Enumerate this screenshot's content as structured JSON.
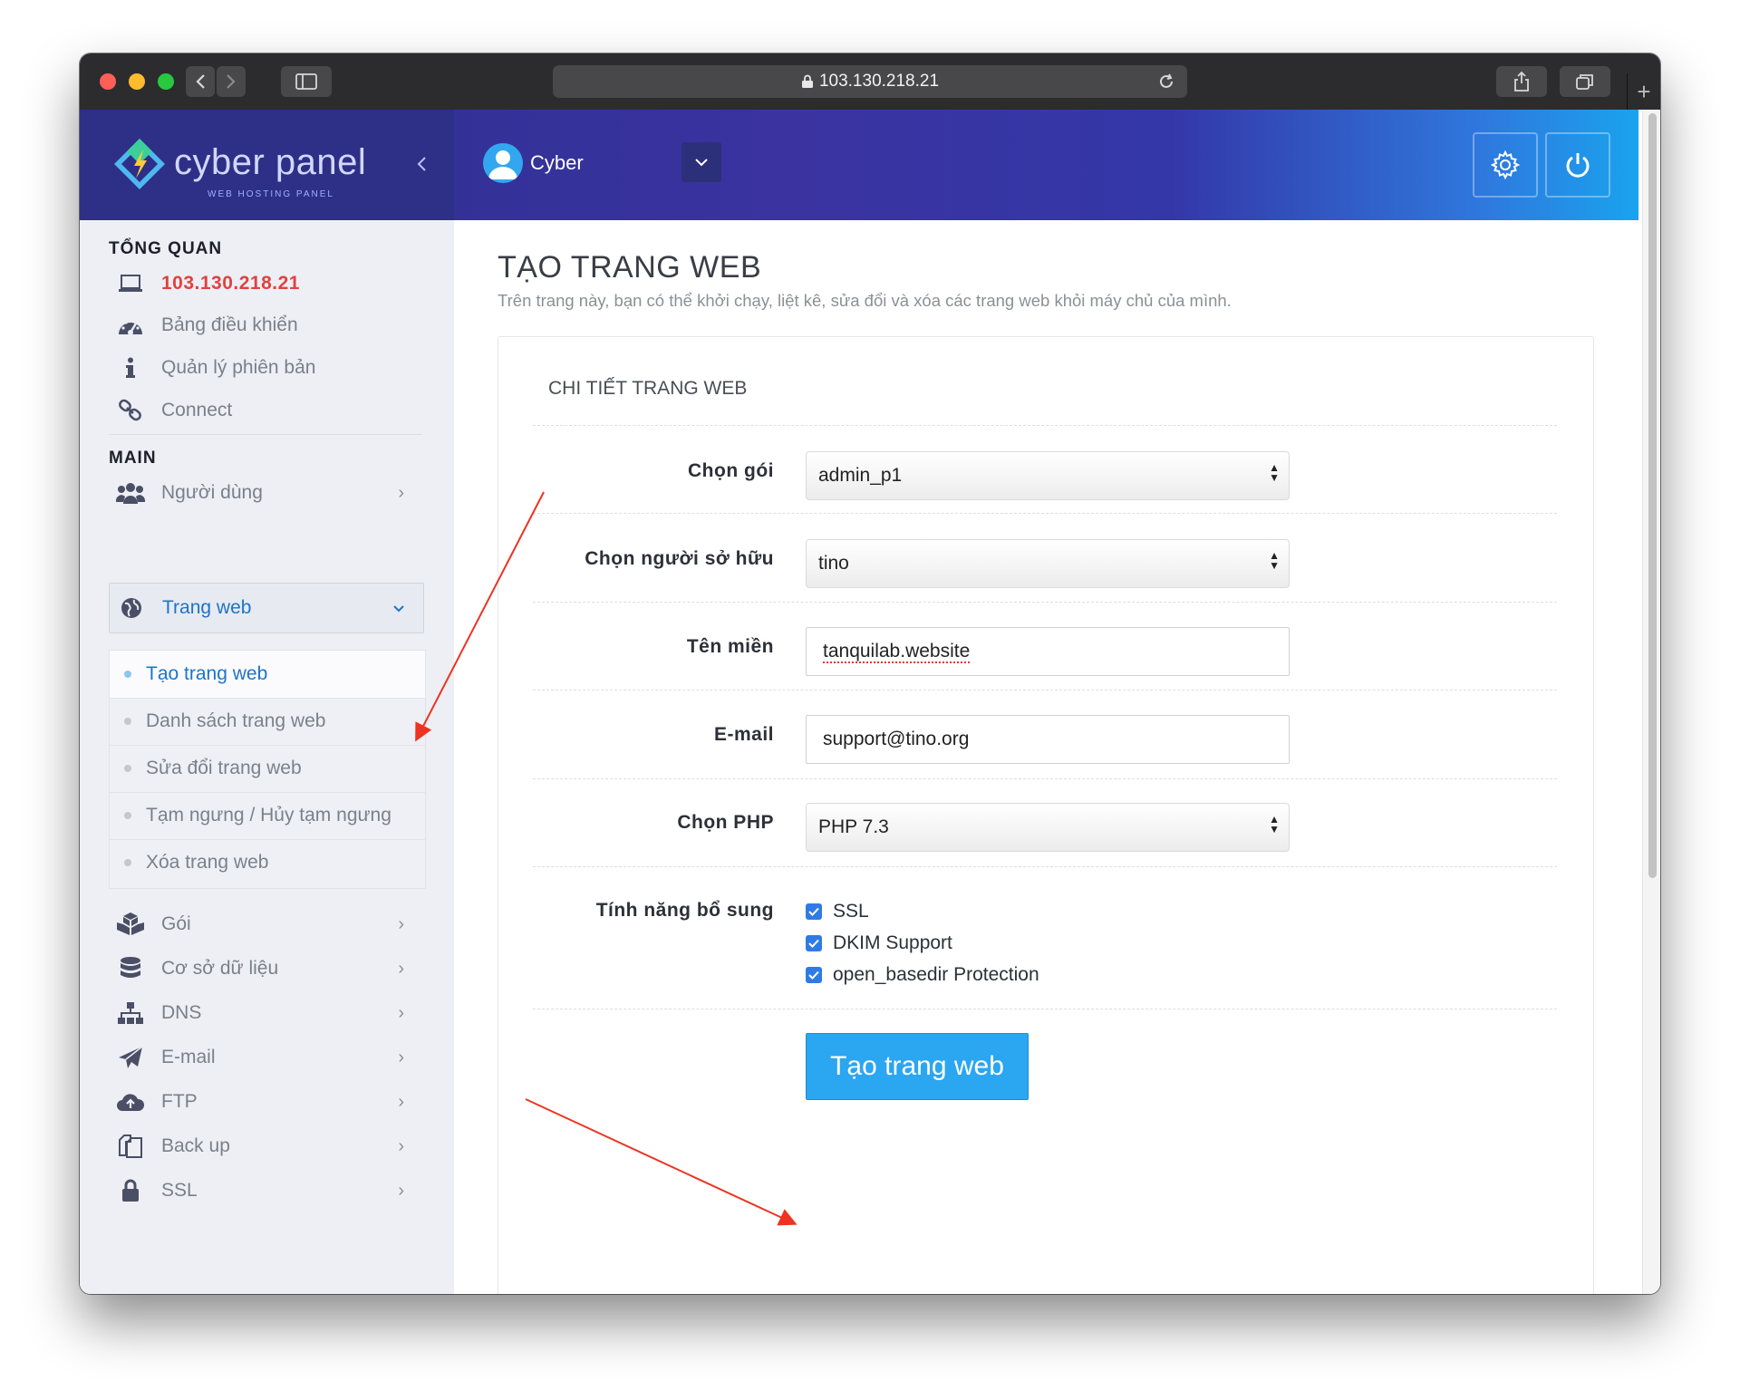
{
  "browser": {
    "url": "103.130.218.21"
  },
  "header": {
    "logo_text": "cyber panel",
    "logo_sub": "WEB HOSTING PANEL",
    "user_name": "Cyber"
  },
  "sidebar": {
    "overview_title": "TỔNG QUAN",
    "server_ip": "103.130.218.21",
    "overview_items": [
      {
        "label": "Bảng điều khiển",
        "icon": "dashboard-icon"
      },
      {
        "label": "Quản lý phiên bản",
        "icon": "info-icon"
      },
      {
        "label": "Connect",
        "icon": "link-icon"
      }
    ],
    "main_title": "MAIN",
    "users_label": "Người dùng",
    "websites_label": "Trang web",
    "website_submenu": [
      {
        "label": "Tạo trang web",
        "active": true
      },
      {
        "label": "Danh sách trang web",
        "active": false
      },
      {
        "label": "Sửa đổi trang web",
        "active": false
      },
      {
        "label": "Tạm ngưng / Hủy tạm ngưng",
        "active": false
      },
      {
        "label": "Xóa trang web",
        "active": false
      }
    ],
    "main_items": [
      {
        "label": "Gói",
        "icon": "packages-icon"
      },
      {
        "label": "Cơ sở dữ liệu",
        "icon": "database-icon"
      },
      {
        "label": "DNS",
        "icon": "sitemap-icon"
      },
      {
        "label": "E-mail",
        "icon": "paper-plane-icon"
      },
      {
        "label": "FTP",
        "icon": "cloud-upload-icon"
      },
      {
        "label": "Back up",
        "icon": "copy-icon"
      },
      {
        "label": "SSL",
        "icon": "lock-icon"
      }
    ]
  },
  "main": {
    "title": "TẠO TRANG WEB",
    "description": "Trên trang này, bạn có thể khởi chạy, liệt kê, sửa đổi và xóa các trang web khỏi máy chủ của mình.",
    "card_title": "CHI TIẾT TRANG WEB",
    "form": {
      "package_label": "Chọn gói",
      "package_value": "admin_p1",
      "owner_label": "Chọn người sở hữu",
      "owner_value": "tino",
      "domain_label": "Tên miền",
      "domain_value": "tanquilab.website",
      "email_label": "E-mail",
      "email_value": "support@tino.org",
      "php_label": "Chọn PHP",
      "php_value": "PHP 7.3",
      "features_label": "Tính năng bổ sung",
      "features": [
        {
          "label": "SSL",
          "checked": true
        },
        {
          "label": "DKIM Support",
          "checked": true
        },
        {
          "label": "open_basedir Protection",
          "checked": true
        }
      ],
      "submit_label": "Tạo trang web"
    }
  },
  "colors": {
    "accent": "#2ba6f1",
    "ip_red": "#e1423e",
    "active_link": "#1d74c7",
    "annotation_arrow": "#ee3322"
  }
}
